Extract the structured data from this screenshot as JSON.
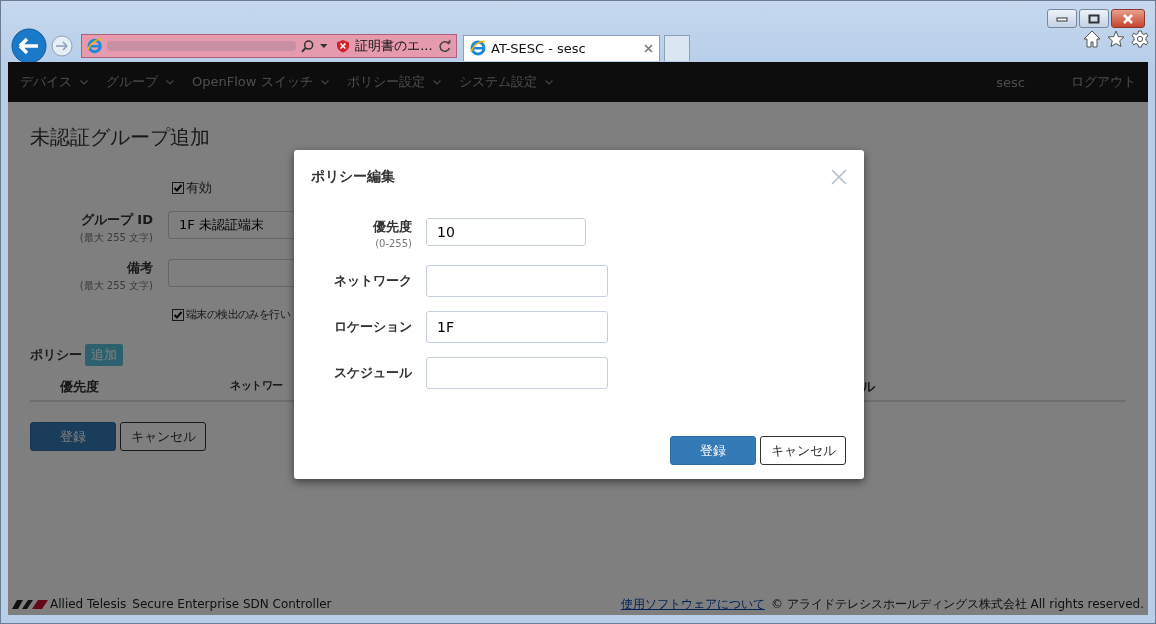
{
  "browser": {
    "address_status": "証明書のエ...",
    "tabs": [
      {
        "title": "AT-SESC - sesc",
        "selected": true
      }
    ]
  },
  "nav": {
    "items": [
      "デバイス",
      "グループ",
      "OpenFlow スイッチ",
      "ポリシー設定",
      "システム設定"
    ],
    "user": "sesc",
    "logout": "ログアウト"
  },
  "page": {
    "title": "未認証グループ追加",
    "enabled": {
      "label": "有効",
      "checked": true
    },
    "fields": [
      {
        "label": "グループ ID",
        "hint": "(最大 255 文字)",
        "value": "1F 未認証端末"
      },
      {
        "label": "備考",
        "hint": "(最大 255 文字)"
      }
    ],
    "detect_only": {
      "label": "端末の検出のみを行い",
      "checked": true
    },
    "policy": {
      "label": "ポリシー",
      "add_button": "追加",
      "columns": [
        "優先度",
        "ネットワー",
        "ル"
      ]
    },
    "buttons": [
      {
        "label": "登録",
        "kind": "primary"
      },
      {
        "label": "キャンセル",
        "kind": "default"
      }
    ]
  },
  "modal": {
    "title": "ポリシー編集",
    "fields": [
      {
        "label": "優先度",
        "hint": "(0-255)",
        "value": "10"
      },
      {
        "label": "ネットワーク"
      },
      {
        "label": "ロケーション",
        "value": "1F"
      },
      {
        "label": "スケジュール"
      }
    ],
    "buttons": [
      {
        "label": "登録",
        "kind": "primary"
      },
      {
        "label": "キャンセル",
        "kind": "default"
      }
    ]
  },
  "footer": {
    "brand": "Allied Telesis",
    "product": "Secure Enterprise SDN Controller",
    "link": "使用ソフトウェアについて",
    "copyright": "© アライドテレシスホールディングス株式会社 All rights reserved."
  }
}
